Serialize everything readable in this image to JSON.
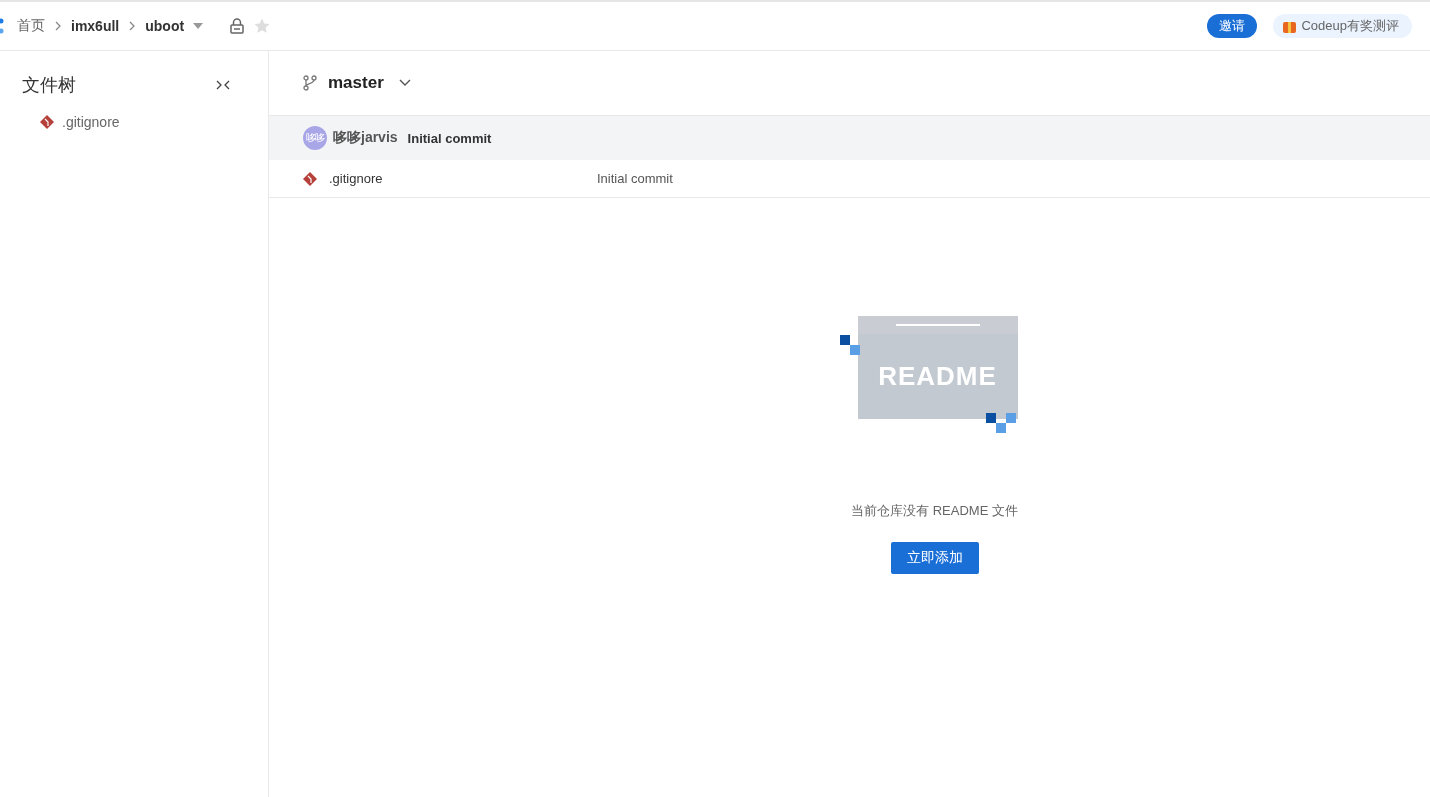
{
  "breadcrumb": [
    {
      "label": "首页",
      "kind": "home"
    },
    {
      "label": "imx6ull",
      "kind": "link"
    },
    {
      "label": "uboot",
      "kind": "repo"
    }
  ],
  "header_buttons": {
    "invite": "邀请",
    "promo": "Codeup有奖测评"
  },
  "sidebar": {
    "title": "文件树",
    "items": [
      {
        "label": ".gitignore"
      }
    ]
  },
  "branch": "master",
  "commit": {
    "avatar": "哆哆",
    "author": "哆哆jarvis",
    "message": "Initial commit"
  },
  "files": [
    {
      "name": ".gitignore",
      "commit": "Initial commit"
    }
  ],
  "readme": {
    "illustration_text": "README",
    "message": "当前仓库没有 README 文件",
    "button": "立即添加"
  }
}
